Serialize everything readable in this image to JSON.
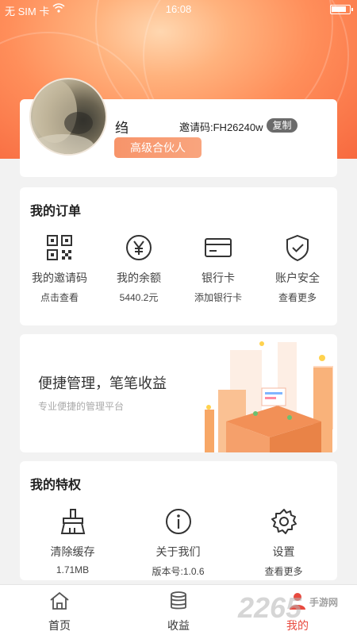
{
  "status_bar": {
    "carrier": "无 SIM 卡",
    "time": "16:08",
    "battery_level": 0.85
  },
  "profile": {
    "username": "绉",
    "invite_code_label": "邀请码:FH26240w",
    "copy_label": "复制",
    "level_label": "高级合伙人"
  },
  "orders": {
    "title": "我的订单",
    "items": [
      {
        "icon": "qr-code-icon",
        "label": "我的邀请码",
        "sub": "点击查看"
      },
      {
        "icon": "yen-icon",
        "label": "我的余额",
        "sub": "5440.2元"
      },
      {
        "icon": "bank-card-icon",
        "label": "银行卡",
        "sub": "添加银行卡"
      },
      {
        "icon": "shield-check-icon",
        "label": "账户安全",
        "sub": "查看更多"
      }
    ]
  },
  "banner": {
    "title": "便捷管理，笔笔收益",
    "subtitle": "专业便捷的管理平台"
  },
  "privileges": {
    "title": "我的特权",
    "items": [
      {
        "icon": "broom-icon",
        "label": "清除缓存",
        "sub": "1.71MB"
      },
      {
        "icon": "info-icon",
        "label": "关于我们",
        "sub": "版本号:1.0.6"
      },
      {
        "icon": "gear-icon",
        "label": "设置",
        "sub": "查看更多"
      }
    ]
  },
  "tabbar": {
    "items": [
      {
        "icon": "home-icon",
        "label": "首页"
      },
      {
        "icon": "coins-icon",
        "label": "收益"
      },
      {
        "icon": "person-icon",
        "label": "我的"
      }
    ],
    "active_index": 2
  },
  "watermark": {
    "text": "2265",
    "sub": "手游网"
  }
}
